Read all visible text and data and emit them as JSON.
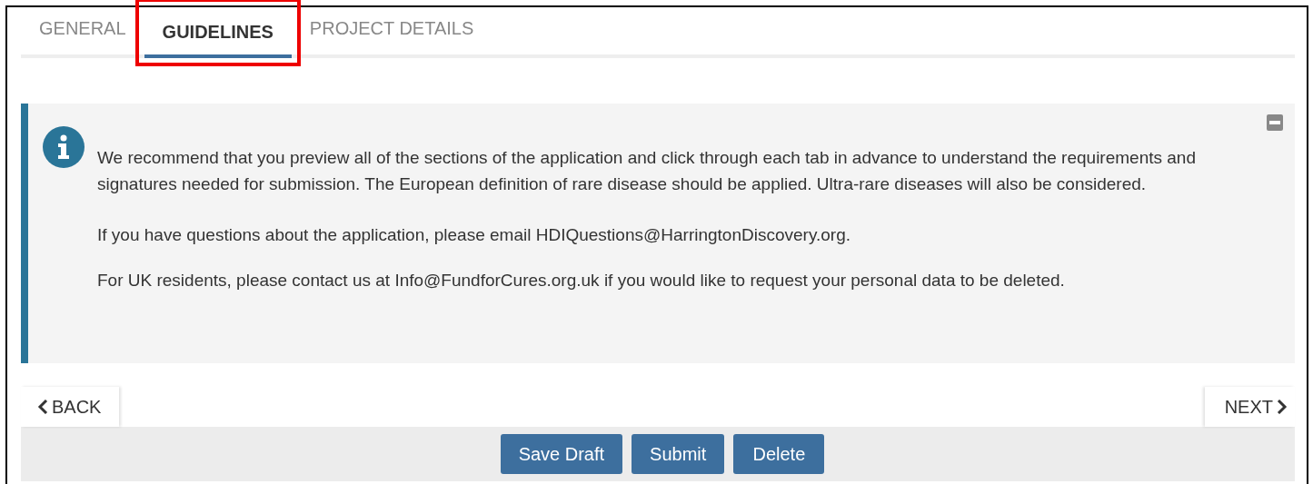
{
  "tabs": [
    {
      "label": "GENERAL",
      "selected": false,
      "highlighted": false
    },
    {
      "label": "GUIDELINES",
      "selected": true,
      "highlighted": true
    },
    {
      "label": "PROJECT DETAILS",
      "selected": false,
      "highlighted": false
    }
  ],
  "notice": {
    "collapsed": false,
    "paragraphs": [
      "We recommend that you preview all of the sections of the application and click through each tab in advance to understand the requirements and signatures needed for submission. The European definition of rare disease should be applied. Ultra-rare diseases will also be considered.",
      "If you have questions about the application, please email HDIQuestions@HarringtonDiscovery.org.",
      "For UK residents, please contact us at Info@FundforCures.org.uk if you would like to request your personal data to be deleted."
    ]
  },
  "nav": {
    "back": "BACK",
    "next": "NEXT"
  },
  "buttons": [
    "Save Draft",
    "Submit",
    "Delete"
  ]
}
